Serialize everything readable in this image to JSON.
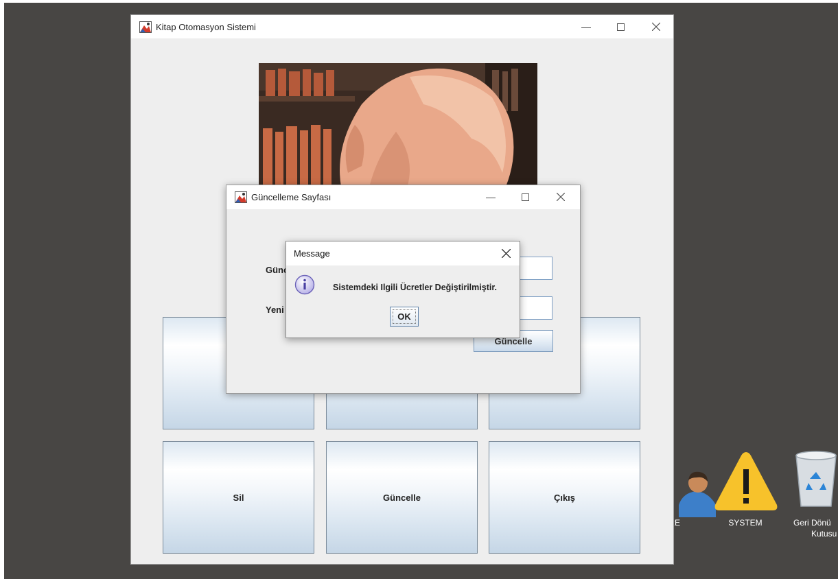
{
  "main_window": {
    "title": "Kitap Otomasyon Sistemi",
    "buttons": {
      "delete": "Sil",
      "update": "Güncelle",
      "exit": "Çıkış"
    }
  },
  "update_dialog": {
    "title": "Güncelleme Sayfası",
    "field1_label_partial": "Günc",
    "field2_label_partial": "Yeni",
    "update_button": "Güncelle"
  },
  "message_dialog": {
    "title": "Message",
    "text": "Sistemdeki Ilgili Ücretler Değiştirilmiştir.",
    "ok_button": "OK"
  },
  "desktop_icons": [
    {
      "label": "ARE",
      "icon": "user-icon"
    },
    {
      "label": "SYSTEM",
      "icon": "warning-icon"
    },
    {
      "label": "Geri Dönü\nKutusu",
      "label_line1": "Geri Dönü",
      "label_line2": "Kutusu",
      "icon": "recycle-bin-icon"
    }
  ],
  "colors": {
    "desktop": "#484644",
    "window_bg": "#eeeeee",
    "button_gradient_bottom": "#c5d6e6",
    "warning_yellow": "#f7c22b"
  }
}
